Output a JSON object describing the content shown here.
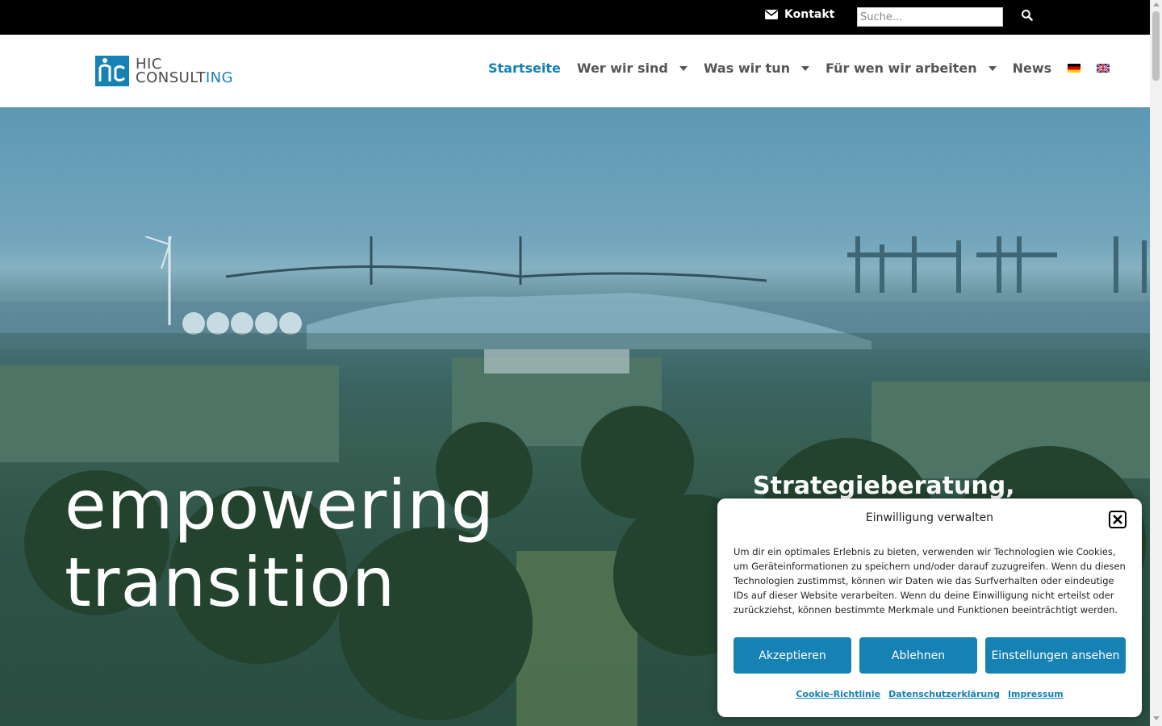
{
  "topbar": {
    "contact_label": "Kontakt",
    "search_placeholder": "Suche..."
  },
  "brand": {
    "line1": "HIC",
    "line2_prefix": "CONSULT",
    "line2_suffix": "ING",
    "accent_color": "#1681b3"
  },
  "nav": {
    "items": [
      {
        "label": "Startseite",
        "active": true,
        "has_dropdown": false
      },
      {
        "label": "Wer wir sind",
        "active": false,
        "has_dropdown": true
      },
      {
        "label": "Was wir tun",
        "active": false,
        "has_dropdown": true
      },
      {
        "label": "Für wen wir arbeiten",
        "active": false,
        "has_dropdown": true
      },
      {
        "label": "News",
        "active": false,
        "has_dropdown": false
      }
    ],
    "languages": [
      "de-flag-icon",
      "en-flag-icon"
    ]
  },
  "hero": {
    "title_line1": "empowering",
    "title_line2": "transition",
    "subtitle": "Strategieberatung,"
  },
  "cookie": {
    "title": "Einwilligung verwalten",
    "text": "Um dir ein optimales Erlebnis zu bieten, verwenden wir Technologien wie Cookies, um Geräteinformationen zu speichern und/oder darauf zuzugreifen. Wenn du diesen Technologien zustimmst, können wir Daten wie das Surfverhalten oder eindeutige IDs auf dieser Website verarbeiten. Wenn du deine Einwilligung nicht erteilst oder zurückziehst, können bestimmte Merkmale und Funktionen beeinträchtigt werden.",
    "accept_label": "Akzeptieren",
    "deny_label": "Ablehnen",
    "settings_label": "Einstellungen ansehen",
    "links": [
      "Cookie-Richtlinie",
      "Datenschutzerklärung",
      "Impressum"
    ]
  }
}
